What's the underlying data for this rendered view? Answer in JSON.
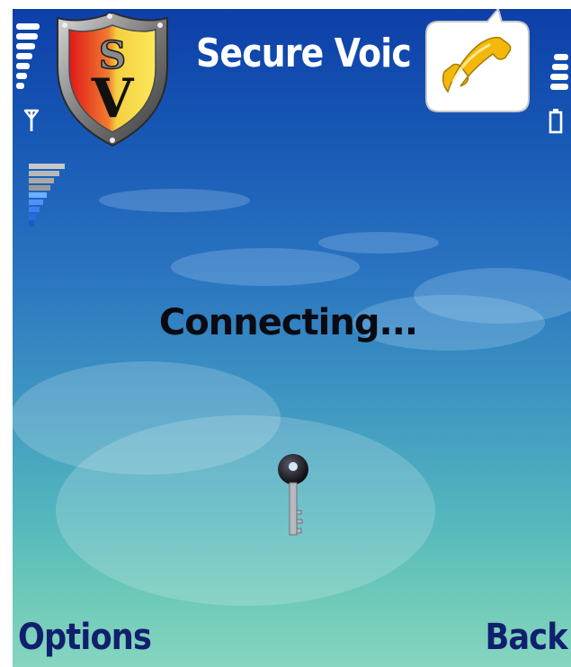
{
  "app": {
    "title": "Secure Voic"
  },
  "status": {
    "message": "Connecting..."
  },
  "softkeys": {
    "left": "Options",
    "right": "Back"
  },
  "icons": {
    "logo": "shield-logo-icon",
    "call": "phone-handset-icon",
    "signal": "antenna-icon",
    "battery": "battery-icon",
    "encryption": "key-icon",
    "audio": "volume-meter-icon"
  },
  "logo_text": "SV",
  "colors": {
    "background_top": "#0d3fa8",
    "background_bottom": "#86d6c0",
    "title": "#ffffff",
    "status_text": "#0a0a12",
    "softkey_text": "#11206e",
    "handset": "#f2b90c"
  }
}
